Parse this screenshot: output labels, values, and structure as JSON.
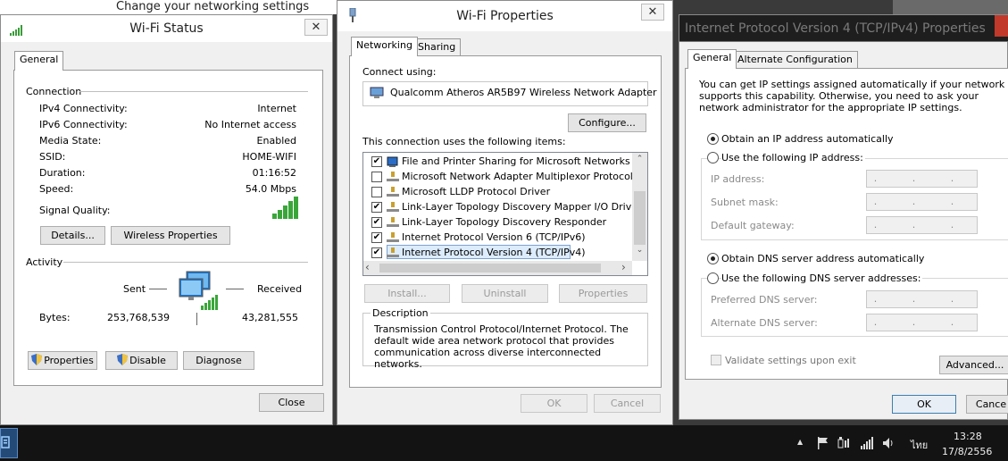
{
  "background": {
    "title": "Change your networking settings"
  },
  "status": {
    "title": "Wi-Fi Status",
    "close_x": "✕",
    "tab": "General",
    "connection": "Connection",
    "rows": [
      {
        "label": "IPv4 Connectivity:",
        "value": "Internet"
      },
      {
        "label": "IPv6 Connectivity:",
        "value": "No Internet access"
      },
      {
        "label": "Media State:",
        "value": "Enabled"
      },
      {
        "label": "SSID:",
        "value": "HOME-WIFI"
      },
      {
        "label": "Duration:",
        "value": "01:16:52"
      },
      {
        "label": "Speed:",
        "value": "54.0 Mbps"
      }
    ],
    "signal_label": "Signal Quality:",
    "details": "Details...",
    "wireless_props": "Wireless Properties",
    "activity": "Activity",
    "sent": "Sent",
    "received": "Received",
    "bytes": "Bytes:",
    "bytes_sent": "253,768,539",
    "bytes_received": "43,281,555",
    "properties": "Properties",
    "disable": "Disable",
    "diagnose": "Diagnose",
    "close": "Close"
  },
  "props": {
    "title": "Wi-Fi Properties",
    "close_x": "✕",
    "tab_networking": "Networking",
    "tab_sharing": "Sharing",
    "connect_using": "Connect using:",
    "adapter": "Qualcomm Atheros AR5B97 Wireless Network Adapter",
    "configure": "Configure...",
    "items_label": "This connection uses the following items:",
    "items": [
      {
        "label": "File and Printer Sharing for Microsoft Networks",
        "checked": "✔"
      },
      {
        "label": "Microsoft Network Adapter Multiplexor Protocol",
        "checked": ""
      },
      {
        "label": "Microsoft LLDP Protocol Driver",
        "checked": ""
      },
      {
        "label": "Link-Layer Topology Discovery Mapper I/O Driver",
        "checked": "✔"
      },
      {
        "label": "Link-Layer Topology Discovery Responder",
        "checked": "✔"
      },
      {
        "label": "Internet Protocol Version 6 (TCP/IPv6)",
        "checked": "✔"
      },
      {
        "label": "Internet Protocol Version 4 (TCP/IPv4)",
        "checked": "✔"
      }
    ],
    "install": "Install...",
    "uninstall": "Uninstall",
    "properties": "Properties",
    "description_title": "Description",
    "description": "Transmission Control Protocol/Internet Protocol. The default wide area network protocol that provides communication across diverse interconnected networks.",
    "ok": "OK",
    "cancel": "Cancel"
  },
  "ipv4": {
    "title": "Internet Protocol Version 4 (TCP/IPv4) Properties",
    "tab_general": "General",
    "tab_alt": "Alternate Configuration",
    "intro": "You can get IP settings assigned automatically if your network supports this capability. Otherwise, you need to ask your network administrator for the appropriate IP settings.",
    "obtain_ip": "Obtain an IP address automatically",
    "use_ip": "Use the following IP address:",
    "ip_address": "IP address:",
    "subnet": "Subnet mask:",
    "gateway": "Default gateway:",
    "obtain_dns": "Obtain DNS server address automatically",
    "use_dns": "Use the following DNS server addresses:",
    "preferred_dns": "Preferred DNS server:",
    "alternate_dns": "Alternate DNS server:",
    "validate": "Validate settings upon exit",
    "advanced": "Advanced...",
    "ok": "OK",
    "cancel": "Cance",
    "ip_dots": ". . ."
  },
  "taskbar": {
    "lang": "ไทย",
    "time": "13:28",
    "date": "17/8/2556",
    "tray_up": "▲"
  }
}
